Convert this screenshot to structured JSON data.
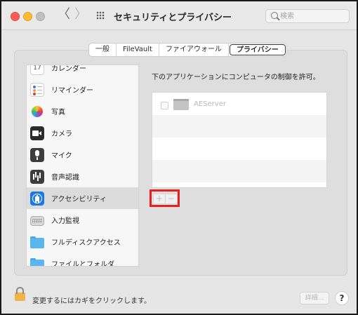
{
  "window": {
    "title": "セキュリティとプライバシー",
    "back_glyph": "〈",
    "forward_glyph": "〉"
  },
  "search": {
    "placeholder": "検索",
    "value": ""
  },
  "tabs": [
    {
      "label": "一般",
      "selected": false
    },
    {
      "label": "FileVault",
      "selected": false
    },
    {
      "label": "ファイアウォール",
      "selected": false
    },
    {
      "label": "プライバシー",
      "selected": true
    }
  ],
  "sidebar": {
    "items": [
      {
        "label": "カレンダー",
        "icon": "calendar-icon",
        "icon_text": "17"
      },
      {
        "label": "リマインダー",
        "icon": "reminders-icon"
      },
      {
        "label": "写真",
        "icon": "photos-icon"
      },
      {
        "label": "カメラ",
        "icon": "camera-icon"
      },
      {
        "label": "マイク",
        "icon": "microphone-icon"
      },
      {
        "label": "音声認識",
        "icon": "speech-recognition-icon"
      },
      {
        "label": "アクセシビリティ",
        "icon": "accessibility-icon",
        "selected": true
      },
      {
        "label": "入力監視",
        "icon": "keyboard-icon"
      },
      {
        "label": "フルディスクアクセス",
        "icon": "folder-icon"
      },
      {
        "label": "ファイルとフォルダ",
        "icon": "folder-icon"
      }
    ]
  },
  "main": {
    "description": "下のアプリケーションにコンピュータの制御を許可。",
    "apps": [
      {
        "name": "AEServer",
        "checked": false
      }
    ],
    "add_label": "+",
    "remove_label": "−"
  },
  "footer": {
    "lock_text": "変更するにはカギをクリックします。",
    "advanced_label": "詳細...",
    "help_label": "?"
  },
  "colors": {
    "accent": "#1a78e8",
    "highlight_box": "#e8201d"
  }
}
